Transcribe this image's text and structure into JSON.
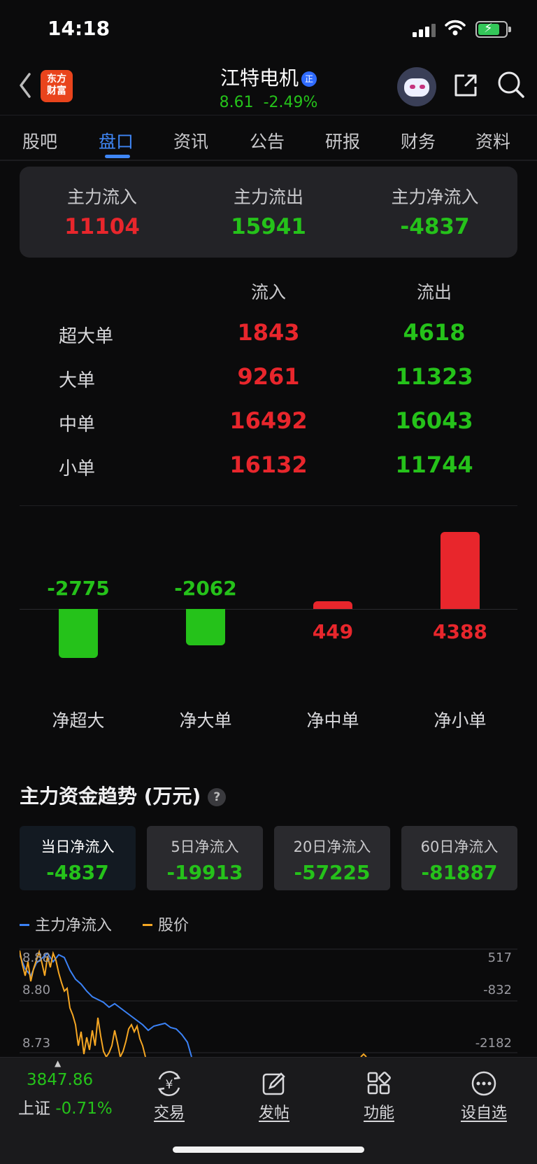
{
  "status": {
    "time": "14:18"
  },
  "header": {
    "logo_line1": "东方",
    "logo_line2": "财富",
    "stock_name": "江特电机",
    "badge": "正",
    "price": "8.61",
    "change": "-2.49%"
  },
  "tabs": [
    "股吧",
    "盘口",
    "资讯",
    "公告",
    "研报",
    "财务",
    "资料"
  ],
  "summary": {
    "inflow_label": "主力流入",
    "inflow": "11104",
    "outflow_label": "主力流出",
    "outflow": "15941",
    "net_label": "主力净流入",
    "net": "-4837"
  },
  "orders": {
    "col_in": "流入",
    "col_out": "流出",
    "rows": [
      {
        "label": "超大单",
        "in": "1843",
        "out": "4618"
      },
      {
        "label": "大单",
        "in": "9261",
        "out": "11323"
      },
      {
        "label": "中单",
        "in": "16492",
        "out": "16043"
      },
      {
        "label": "小单",
        "in": "16132",
        "out": "11744"
      }
    ]
  },
  "net_bars": [
    {
      "label": "净超大",
      "value": -2775
    },
    {
      "label": "净大单",
      "value": -2062
    },
    {
      "label": "净中单",
      "value": 449
    },
    {
      "label": "净小单",
      "value": 4388
    }
  ],
  "trend": {
    "title": "主力资金趋势 (万元)",
    "help": "?",
    "periods": [
      {
        "label": "当日净流入",
        "value": "-4837"
      },
      {
        "label": "5日净流入",
        "value": "-19913"
      },
      {
        "label": "20日净流入",
        "value": "-57225"
      },
      {
        "label": "60日净流入",
        "value": "-81887"
      }
    ],
    "legend_flow": "主力净流入",
    "legend_price": "股价",
    "left_ticks": [
      "8.88",
      "8.80",
      "8.73"
    ],
    "right_ticks": [
      "517",
      "-832",
      "-2182"
    ]
  },
  "colors": {
    "up": "#e8262c",
    "down": "#25c21a",
    "accent": "#3f86f5",
    "flow_line": "#3b82f6",
    "price_line": "#f5a623"
  },
  "bottom": {
    "index_value": "3847.86",
    "index_name": "上证",
    "index_change": "-0.71%",
    "nav": [
      {
        "label": "交易",
        "icon": "trade-yen-icon"
      },
      {
        "label": "发帖",
        "icon": "compose-icon"
      },
      {
        "label": "功能",
        "icon": "apps-grid-icon"
      },
      {
        "label": "设自选",
        "icon": "more-dots-icon"
      }
    ]
  }
}
